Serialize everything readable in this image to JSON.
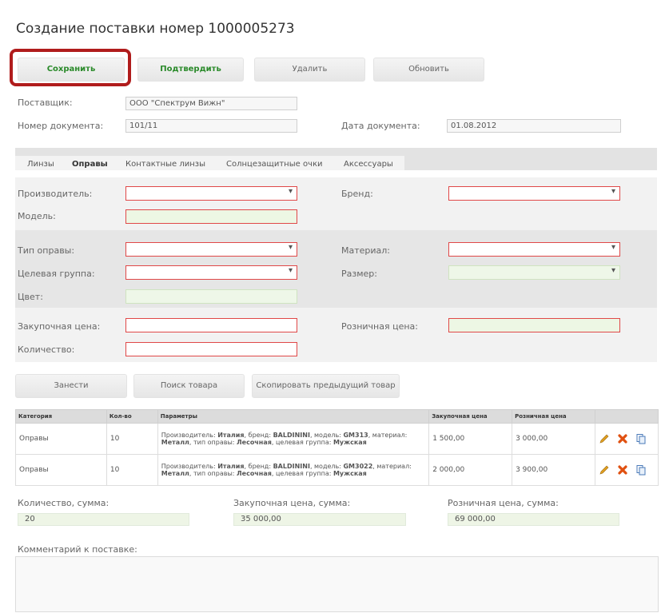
{
  "page": {
    "title": "Создание поставки номер 1000005273"
  },
  "toolbar": {
    "save": "Сохранить",
    "confirm": "Подтвердить",
    "delete": "Удалить",
    "refresh": "Обновить"
  },
  "header": {
    "supplier_label": "Поставщик:",
    "supplier_value": "ООО \"Спектрум Вижн\"",
    "doc_number_label": "Номер документа:",
    "doc_number_value": "101/11",
    "doc_date_label": "Дата документа:",
    "doc_date_value": "01.08.2012"
  },
  "tabs": [
    {
      "label": "Линзы",
      "active": false
    },
    {
      "label": "Оправы",
      "active": true
    },
    {
      "label": "Контактные линзы",
      "active": false
    },
    {
      "label": "Солнцезащитные очки",
      "active": false
    },
    {
      "label": "Аксессуары",
      "active": false
    }
  ],
  "form": {
    "manufacturer_label": "Производитель:",
    "brand_label": "Бренд:",
    "model_label": "Модель:",
    "frame_type_label": "Тип оправы:",
    "material_label": "Материал:",
    "target_group_label": "Целевая группа:",
    "size_label": "Размер:",
    "color_label": "Цвет:",
    "purchase_price_label": "Закупочная цена:",
    "retail_price_label": "Розничная цена:",
    "quantity_label": "Количество:"
  },
  "actions": {
    "add": "Занести",
    "search": "Поиск товара",
    "copy": "Скопировать предыдущий товар"
  },
  "table": {
    "headers": [
      "Категория",
      "Кол-во",
      "Параметры",
      "Закупочная цена",
      "Розничная цена",
      ""
    ],
    "rows": [
      {
        "category": "Оправы",
        "qty": "10",
        "p1": "Производитель: ",
        "p1b": "Италия",
        "p2": ", бренд: ",
        "p2b": "BALDININI",
        "p3": ", модель: ",
        "p3b": "GM313",
        "p4": ", материал: ",
        "p4b": "Металл",
        "p5": ", тип оправы: ",
        "p5b": "Лесочная",
        "p6": ", целевая группа: ",
        "p6b": "Мужская",
        "purchase": "1 500,00",
        "retail": "3 000,00"
      },
      {
        "category": "Оправы",
        "qty": "10",
        "p1": "Производитель: ",
        "p1b": "Италия",
        "p2": ", бренд: ",
        "p2b": "BALDININI",
        "p3": ", модель: ",
        "p3b": "GM3022",
        "p4": ", материал: ",
        "p4b": "Металл",
        "p5": ", тип оправы: ",
        "p5b": "Лесочная",
        "p6": ", целевая группа: ",
        "p6b": "Мужская",
        "purchase": "2 000,00",
        "retail": "3 900,00"
      }
    ],
    "row_icons": [
      "pencil-icon",
      "delete-cross-icon",
      "copy-icon"
    ]
  },
  "totals": {
    "qty_label": "Количество, сумма:",
    "qty_value": "20",
    "purchase_label": "Закупочная цена, сумма:",
    "purchase_value": "35 000,00",
    "retail_label": "Розничная цена, сумма:",
    "retail_value": "69 000,00"
  },
  "comment": {
    "label": "Комментарий к поставке:",
    "value": ""
  },
  "colors": {
    "highlight": "#b01c1c",
    "required_border": "#e04848",
    "green_text": "#2a8a2a",
    "green_fill": "#eef7e8"
  }
}
